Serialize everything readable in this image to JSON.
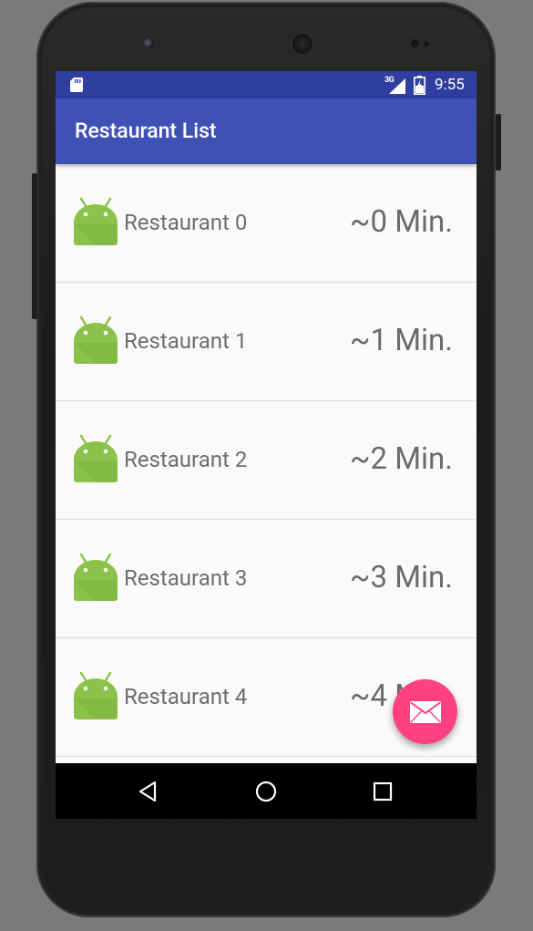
{
  "status_bar": {
    "network": "3G",
    "time": "9:55",
    "icons": [
      "sd-card-icon",
      "signal-icon",
      "battery-icon"
    ]
  },
  "app_bar": {
    "title": "Restaurant List"
  },
  "restaurants": [
    {
      "name": "Restaurant 0",
      "time": "~0 Min.",
      "icon": "android-icon"
    },
    {
      "name": "Restaurant 1",
      "time": "~1 Min.",
      "icon": "android-icon"
    },
    {
      "name": "Restaurant 2",
      "time": "~2 Min.",
      "icon": "android-icon"
    },
    {
      "name": "Restaurant 3",
      "time": "~3 Min.",
      "icon": "android-icon"
    },
    {
      "name": "Restaurant 4",
      "time": "~4 Min.",
      "icon": "android-icon"
    }
  ],
  "fab": {
    "icon": "email-icon"
  },
  "nav_bar": {
    "buttons": [
      "back-icon",
      "home-icon",
      "recents-icon"
    ]
  },
  "colors": {
    "status_bar": "#303f9f",
    "app_bar": "#3f51b5",
    "fab": "#ff4081",
    "android_green": "#8bc34a"
  }
}
